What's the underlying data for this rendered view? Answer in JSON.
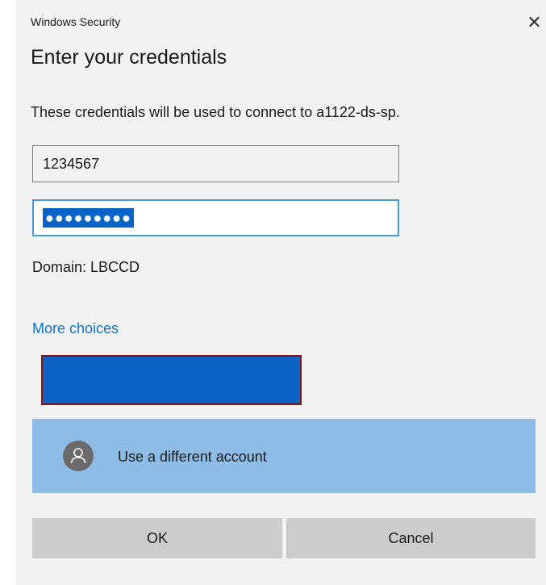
{
  "window": {
    "title": "Windows Security",
    "close_glyph": "✕",
    "close_icon": "close-icon"
  },
  "heading": "Enter your credentials",
  "description": "These credentials will be used to connect to a1122-ds-sp.",
  "username": {
    "value": "1234567"
  },
  "password": {
    "masked_value": "●●●●●●●●●",
    "selected": true
  },
  "domain_text": "Domain: LBCCD",
  "more_choices": "More choices",
  "different_account": {
    "label": "Use a different account",
    "icon": "user-icon"
  },
  "buttons": {
    "ok": "OK",
    "cancel": "Cancel"
  },
  "colors": {
    "link": "#1270c8",
    "selection": "#0a64c8",
    "focus_border": "#4a9ad8",
    "tile_fill": "#0a62c2",
    "tile_border": "#8a1216",
    "hover_row": "#8dbde6"
  }
}
